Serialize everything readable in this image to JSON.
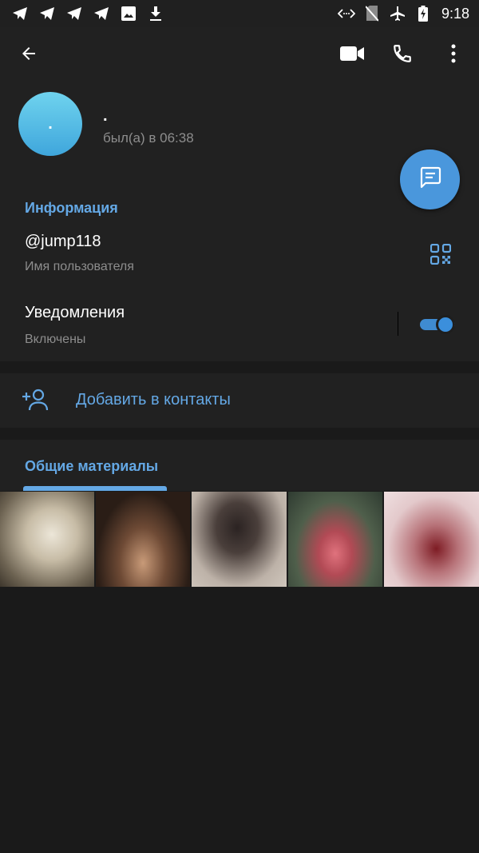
{
  "status_bar": {
    "time": "9:18",
    "left_icons": [
      "telegram-icon",
      "telegram-icon",
      "telegram-icon",
      "telegram-icon",
      "image-icon",
      "download-icon"
    ],
    "right_icons": [
      "data-saver-icon",
      "no-sim-icon",
      "airplane-icon",
      "battery-charging-icon"
    ]
  },
  "toolbar": {
    "back_icon": "arrow-left-icon",
    "video_icon": "videocam-icon",
    "call_icon": "phone-icon",
    "more_icon": "more-vert-icon"
  },
  "profile": {
    "avatar_initial": ".",
    "name": ".",
    "status": "был(а) в 06:38",
    "avatar_colors": [
      "#6fd3ee",
      "#3fa6dc"
    ]
  },
  "fab": {
    "icon": "message-icon",
    "color": "#4a97dc"
  },
  "info": {
    "title": "Информация",
    "username": "@jump118",
    "username_caption": "Имя пользователя",
    "qr_icon": "qr-code-icon",
    "notifications_label": "Уведомления",
    "notifications_state": "Включены",
    "notifications_enabled": true
  },
  "actions": {
    "add_contact_label": "Добавить в контакты",
    "add_contact_icon": "person-add-icon"
  },
  "shared_media": {
    "title": "Общие материалы",
    "items": [
      "media-1",
      "media-2",
      "media-3",
      "media-4",
      "media-5"
    ]
  },
  "colors": {
    "accent": "#64a8e5",
    "background": "#1a1a1a",
    "surface": "#212121",
    "secondary_text": "#8d8d8d"
  }
}
